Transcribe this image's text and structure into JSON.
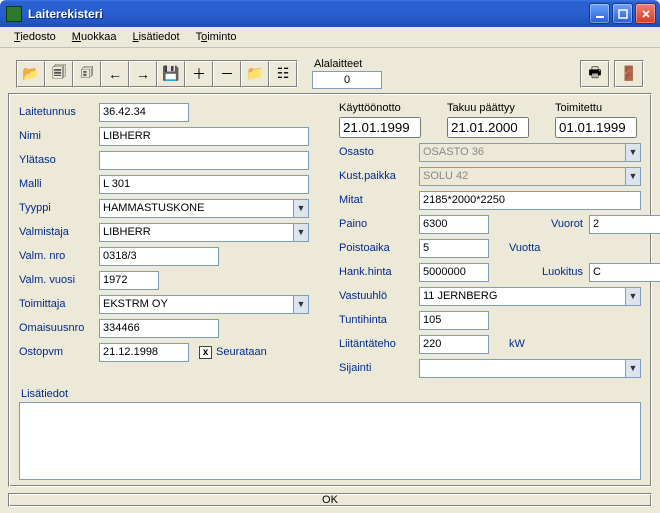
{
  "window": {
    "title": "Laiterekisteri"
  },
  "menu": {
    "tiedosto": "Tiedosto",
    "muokkaa": "Muokkaa",
    "lisatiedot": "Lisätiedot",
    "toiminto": "Toiminto"
  },
  "toolbar": {
    "alalaitteet_label": "Alalaitteet",
    "alalaitteet_value": "0"
  },
  "left": {
    "laitetunnus_label": "Laitetunnus",
    "laitetunnus": "36.42.34",
    "nimi_label": "Nimi",
    "nimi": "LIBHERR",
    "ylataso_label": "Ylätaso",
    "ylataso": "",
    "malli_label": "Malli",
    "malli": "L 301",
    "tyyppi_label": "Tyyppi",
    "tyyppi": "HAMMASTUSKONE",
    "valmistaja_label": "Valmistaja",
    "valmistaja": "LIBHERR",
    "valmnro_label": "Valm. nro",
    "valmnro": "0318/3",
    "valmvuosi_label": "Valm. vuosi",
    "valmvuosi": "1972",
    "toimittaja_label": "Toimittaja",
    "toimittaja": "EKSTRM OY",
    "omaisuusnro_label": "Omaisuusnro",
    "omaisuusnro": "334466",
    "ostopvm_label": "Ostopvm",
    "ostopvm": "21.12.1998",
    "seurataan_label": "Seurataan",
    "seurataan_checked": true
  },
  "right": {
    "kayttoonotto_label": "Käyttöönotto",
    "kayttoonotto": "21.01.1999",
    "takuu_label": "Takuu päättyy",
    "takuu": "21.01.2000",
    "toimitettu_label": "Toimitettu",
    "toimitettu": "01.01.1999",
    "osasto_label": "Osasto",
    "osasto": "OSASTO 36",
    "kustpaikka_label": "Kust.paikka",
    "kustpaikka": "SOLU 42",
    "mitat_label": "Mitat",
    "mitat": "2185*2000*2250",
    "paino_label": "Paino",
    "paino": "6300",
    "vuorot_label": "Vuorot",
    "vuorot": "2",
    "poistoaika_label": "Poistoaika",
    "poistoaika": "5",
    "vuotta_label": "Vuotta",
    "hankhinta_label": "Hank.hinta",
    "hankhinta": "5000000",
    "luokitus_label": "Luokitus",
    "luokitus": "C",
    "vastuuhlo_label": "Vastuuhlö",
    "vastuuhlo": "11 JERNBERG",
    "tuntihinta_label": "Tuntihinta",
    "tuntihinta": "105",
    "liitantateho_label": "Liitäntäteho",
    "liitantateho": "220",
    "kw_label": "kW",
    "sijainti_label": "Sijainti",
    "sijainti": ""
  },
  "lisatiedot": {
    "label": "Lisätiedot",
    "value": ""
  },
  "status": {
    "text": "OK"
  }
}
